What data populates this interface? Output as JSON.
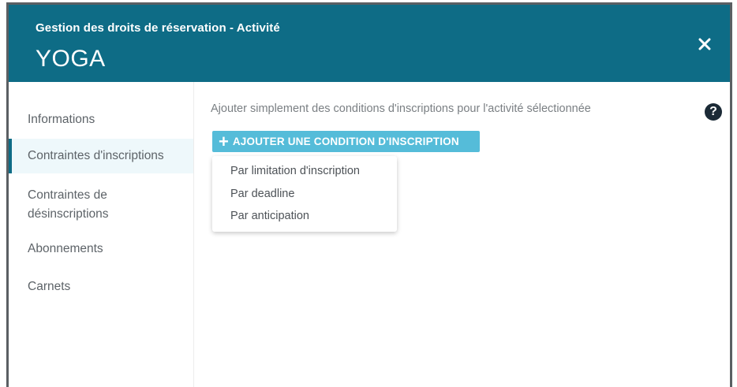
{
  "header": {
    "subtitle": "Gestion des droits de réservation - Activité",
    "title": "YOGA",
    "close_icon": "close-icon"
  },
  "sidebar": {
    "items": [
      {
        "label": "Informations",
        "active": false
      },
      {
        "label": "Contraintes d'inscriptions",
        "active": true
      },
      {
        "label": "Contraintes de désinscriptions",
        "active": false
      },
      {
        "label": "Abonnements",
        "active": false
      },
      {
        "label": "Carnets",
        "active": false
      }
    ]
  },
  "main": {
    "hint": "Ajouter simplement des conditions d'inscriptions pour l'activité sélectionnée",
    "help_icon": "question-mark-icon",
    "add_button": {
      "icon": "+",
      "label": "AJOUTER UNE CONDITION D'INSCRIPTION"
    },
    "dropdown": {
      "options": [
        "Par limitation d'inscription",
        "Par deadline",
        "Par anticipation"
      ]
    }
  },
  "colors": {
    "header_bg": "#0e6c86",
    "button_bg": "#55bcd9",
    "active_item_bg": "#eef8fb"
  }
}
